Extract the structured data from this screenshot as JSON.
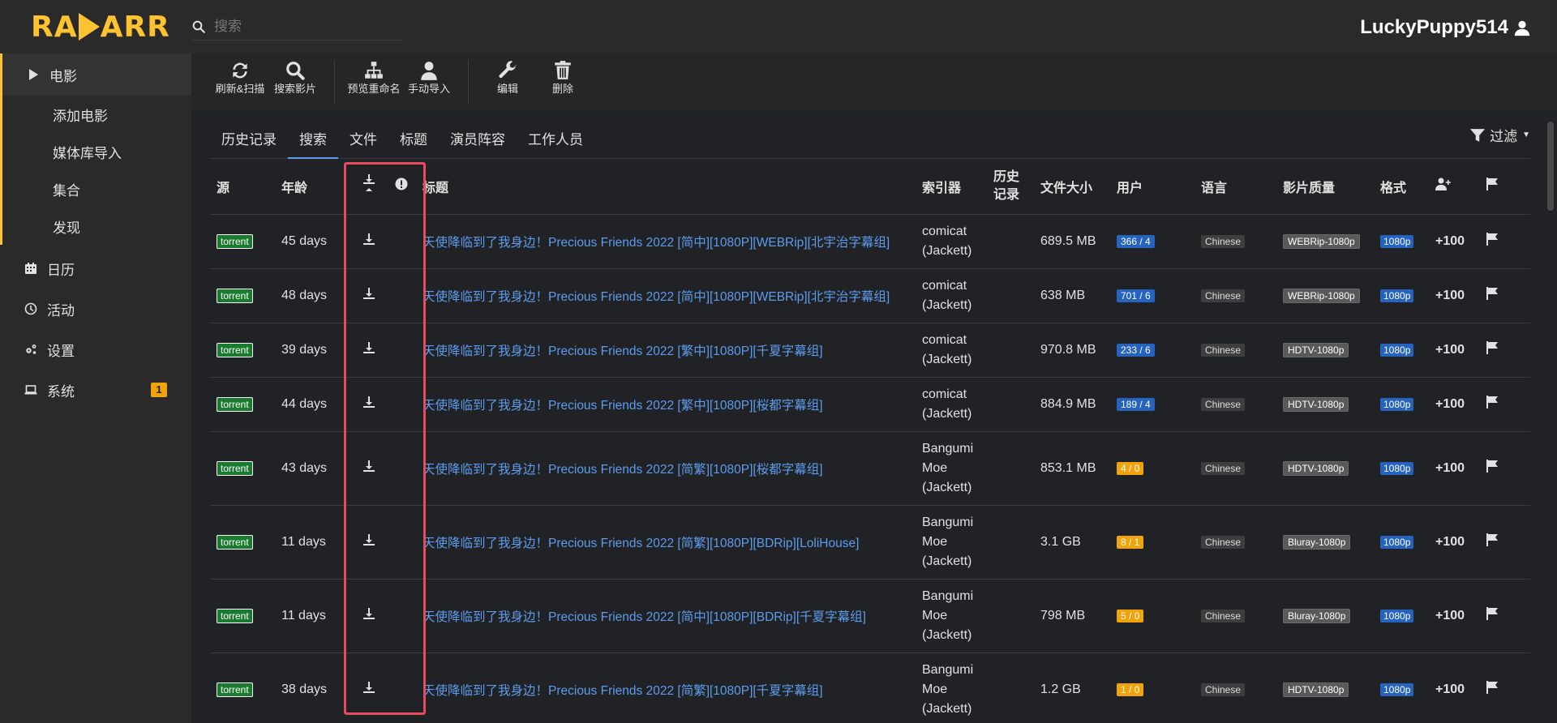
{
  "app": {
    "logo_text_left": "RA",
    "logo_text_right": "ARR",
    "user": "LuckyPuppy514"
  },
  "search": {
    "placeholder": "搜索"
  },
  "sidebar": {
    "movies": "电影",
    "sub": [
      "添加电影",
      "媒体库导入",
      "集合",
      "发现"
    ],
    "calendar": "日历",
    "activity": "活动",
    "settings": "设置",
    "system": "系统",
    "system_badge": "1"
  },
  "toolbar": {
    "refresh": "刷新&扫描",
    "search": "搜索影片",
    "preview_rename": "预览重命名",
    "manual_import": "手动导入",
    "edit": "编辑",
    "delete": "删除"
  },
  "tabs": [
    "历史记录",
    "搜索",
    "文件",
    "标题",
    "演员阵容",
    "工作人员"
  ],
  "filter": "过滤",
  "columns": {
    "source": "源",
    "age": "年龄",
    "title": "标题",
    "indexer": "索引器",
    "history": "历史记录",
    "size": "文件大小",
    "peers": "用户",
    "language": "语言",
    "quality": "影片质量",
    "format": "格式"
  },
  "rows": [
    {
      "src": "torrent",
      "age": "45 days",
      "title": "天使降临到了我身边！Precious Friends 2022 [简中][1080P][WEBRip][北宇治字幕组]",
      "idx1": "comicat",
      "idx2": "",
      "idx3": "(Jackett)",
      "size": "689.5 MB",
      "peers": "366 / 4",
      "peer_color": "blue",
      "lang": "Chinese",
      "qual": "WEBRip-1080p",
      "fmt": "1080p",
      "score": "+100"
    },
    {
      "src": "torrent",
      "age": "48 days",
      "title": "天使降临到了我身边！Precious Friends 2022 [简中][1080P][WEBRip][北宇治字幕组]",
      "idx1": "comicat",
      "idx2": "",
      "idx3": "(Jackett)",
      "size": "638 MB",
      "peers": "701 / 6",
      "peer_color": "blue",
      "lang": "Chinese",
      "qual": "WEBRip-1080p",
      "fmt": "1080p",
      "score": "+100"
    },
    {
      "src": "torrent",
      "age": "39 days",
      "title": "天使降临到了我身边！Precious Friends 2022 [繁中][1080P][千夏字幕组]",
      "idx1": "comicat",
      "idx2": "",
      "idx3": "(Jackett)",
      "size": "970.8 MB",
      "peers": "233 / 6",
      "peer_color": "blue",
      "lang": "Chinese",
      "qual": "HDTV-1080p",
      "fmt": "1080p",
      "score": "+100"
    },
    {
      "src": "torrent",
      "age": "44 days",
      "title": "天使降临到了我身边！Precious Friends 2022 [繁中][1080P][桜都字幕组]",
      "idx1": "comicat",
      "idx2": "",
      "idx3": "(Jackett)",
      "size": "884.9 MB",
      "peers": "189 / 4",
      "peer_color": "blue",
      "lang": "Chinese",
      "qual": "HDTV-1080p",
      "fmt": "1080p",
      "score": "+100"
    },
    {
      "src": "torrent",
      "age": "43 days",
      "title": "天使降临到了我身边！Precious Friends 2022 [简繁][1080P][桜都字幕组]",
      "idx1": "Bangumi",
      "idx2": "Moe",
      "idx3": "(Jackett)",
      "size": "853.1 MB",
      "peers": "4 / 0",
      "peer_color": "orange",
      "lang": "Chinese",
      "qual": "HDTV-1080p",
      "fmt": "1080p",
      "score": "+100"
    },
    {
      "src": "torrent",
      "age": "11 days",
      "title": "天使降临到了我身边！Precious Friends 2022 [简繁][1080P][BDRip][LoliHouse]",
      "idx1": "Bangumi",
      "idx2": "Moe",
      "idx3": "(Jackett)",
      "size": "3.1 GB",
      "peers": "8 / 1",
      "peer_color": "orange",
      "lang": "Chinese",
      "qual": "Bluray-1080p",
      "fmt": "1080p",
      "score": "+100"
    },
    {
      "src": "torrent",
      "age": "11 days",
      "title": "天使降临到了我身边！Precious Friends 2022 [简中][1080P][BDRip][千夏字幕组]",
      "idx1": "Bangumi",
      "idx2": "Moe",
      "idx3": "(Jackett)",
      "size": "798 MB",
      "peers": "5 / 0",
      "peer_color": "orange",
      "lang": "Chinese",
      "qual": "Bluray-1080p",
      "fmt": "1080p",
      "score": "+100"
    },
    {
      "src": "torrent",
      "age": "38 days",
      "title": "天使降临到了我身边！Precious Friends 2022 [简繁][1080P][千夏字幕组]",
      "idx1": "Bangumi",
      "idx2": "Moe",
      "idx3": "(Jackett)",
      "size": "1.2 GB",
      "peers": "1 / 0",
      "peer_color": "orange",
      "lang": "Chinese",
      "qual": "HDTV-1080p",
      "fmt": "1080p",
      "score": "+100"
    }
  ],
  "colors": {
    "accent": "#ffc230",
    "link": "#5d9cec",
    "highlight_box": "#e84a5f"
  }
}
